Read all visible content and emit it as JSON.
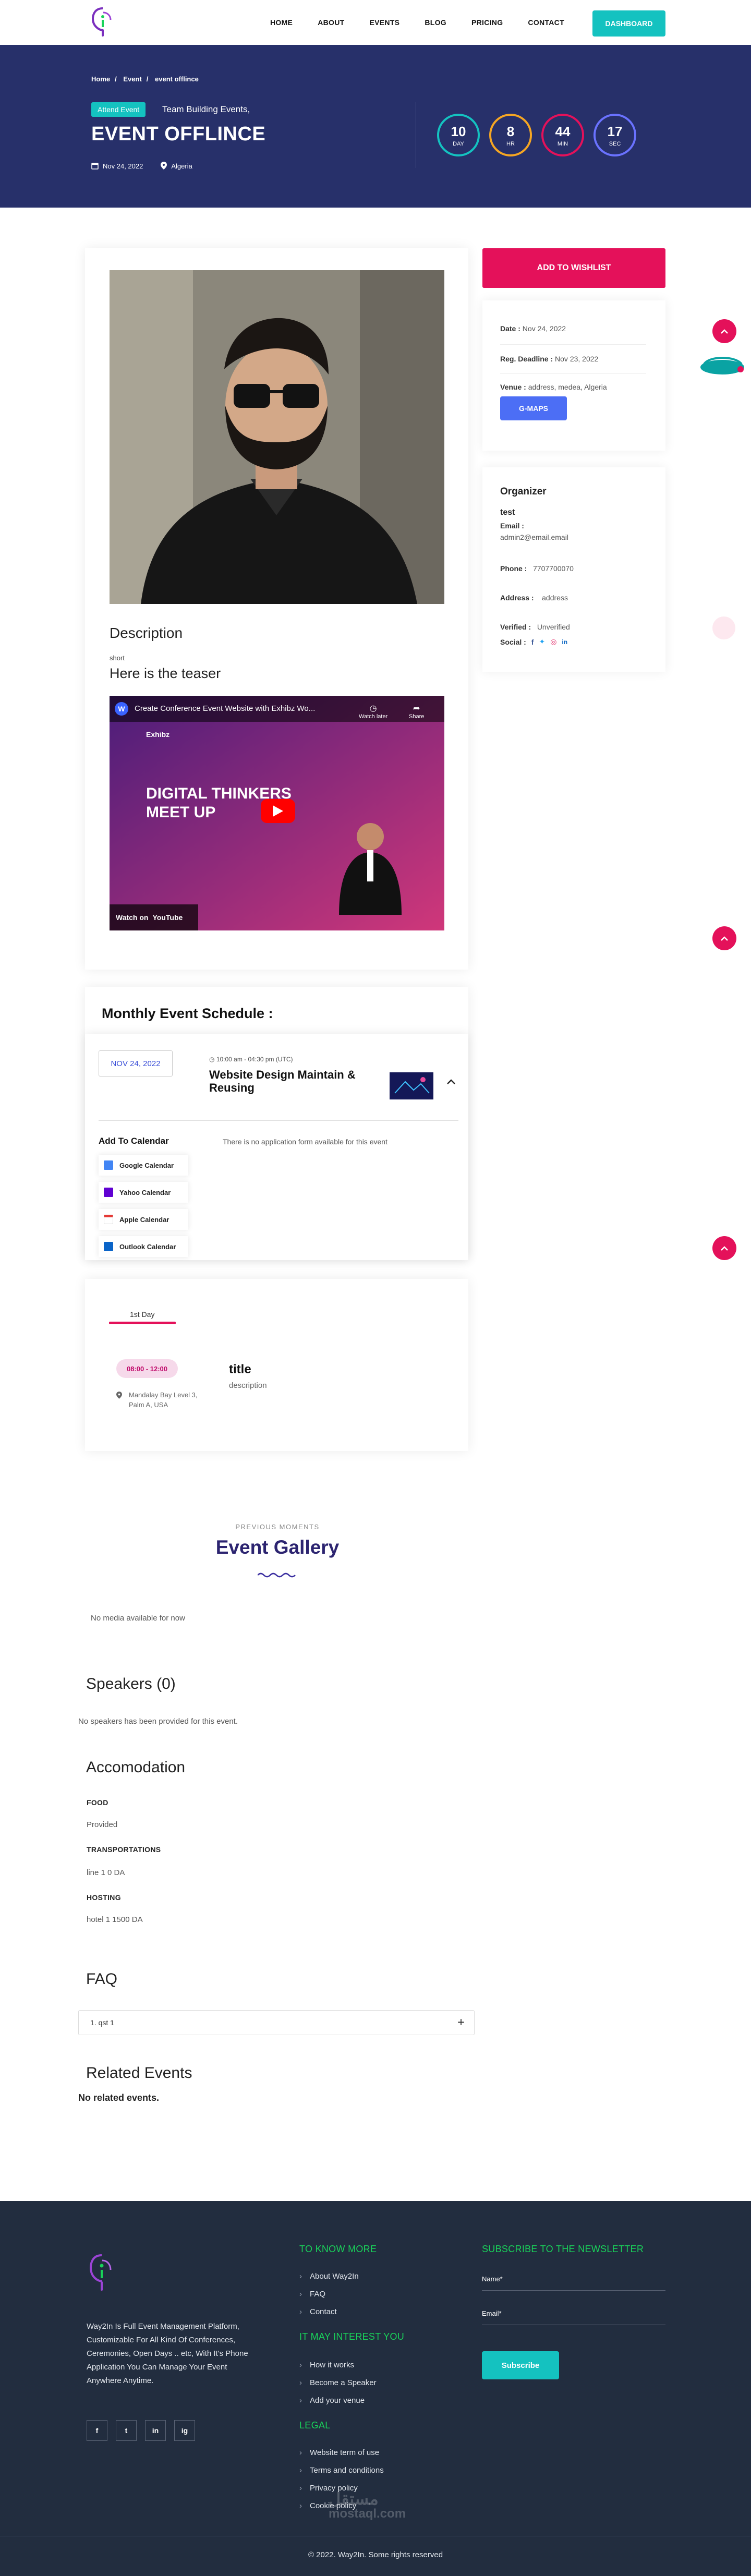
{
  "nav": {
    "items": [
      "HOME",
      "ABOUT",
      "EVENTS",
      "BLOG",
      "PRICING",
      "CONTACT"
    ],
    "dashboard_label": "DASHBOARD"
  },
  "hero": {
    "breadcrumb": [
      "Home",
      "Event",
      "event offlince"
    ],
    "badge": "Attend Event",
    "category": "Team Building Events,",
    "title": "EVENT OFFLINCE",
    "date": "Nov 24, 2022",
    "location": "Algeria",
    "countdown": [
      {
        "value": "10",
        "unit": "DAY",
        "color": "#14c2c0"
      },
      {
        "value": "8",
        "unit": "HR",
        "color": "#f5a623"
      },
      {
        "value": "44",
        "unit": "MIN",
        "color": "#e4115a"
      },
      {
        "value": "17",
        "unit": "SEC",
        "color": "#6a72ff"
      }
    ]
  },
  "main": {
    "description_heading": "Description",
    "short_label": "short",
    "teaser": "Here is the teaser",
    "video": {
      "title": "Create Conference Event Website with Exhibz Wo...",
      "watch_later": "Watch later",
      "share": "Share",
      "brand": "Exhibz",
      "headline_1": "DIGITAL THINKERS",
      "headline_2": "MEET UP",
      "watch_on": "Watch on",
      "youtube": "YouTube"
    }
  },
  "sidebar": {
    "wishlist_label": "ADD TO WISHLIST",
    "date_label": "Date :",
    "date_value": "Nov 24, 2022",
    "deadline_label": "Reg. Deadline :",
    "deadline_value": "Nov 23, 2022",
    "venue_label": "Venue :",
    "venue_value": "address, medea, Algeria",
    "gmaps_label": "G-MAPS",
    "organizer_heading": "Organizer",
    "organizer_name": "test",
    "email_label": "Email :",
    "email_value": "admin2@email.email",
    "phone_label": "Phone :",
    "phone_value": "7707700070",
    "address_label": "Address :",
    "address_value": "address",
    "verified_label": "Verified :",
    "verified_value": "Unverified",
    "social_label": "Social :"
  },
  "schedule": {
    "heading": "Monthly Event Schedule :",
    "date": "NOV 24, 2022",
    "time": "10:00 am - 04:30 pm (UTC)",
    "title": "Website Design Maintain & Reusing",
    "add_to_calendar": "Add To Calendar",
    "no_form": "There is no application form available for this event",
    "calendars": [
      {
        "label": "Google Calendar",
        "color": "#4285f4"
      },
      {
        "label": "Yahoo Calendar",
        "color": "#6001d2"
      },
      {
        "label": "Apple Calendar",
        "color": "#e53935"
      },
      {
        "label": "Outlook Calendar",
        "color": "#0a64c8"
      }
    ]
  },
  "agenda": {
    "day": "1st Day",
    "time": "08:00 - 12:00",
    "location": "Mandalay Bay Level 3, Palm A, USA",
    "title": "title",
    "description": "description"
  },
  "gallery": {
    "pre": "PREVIOUS MOMENTS",
    "heading": "Event Gallery",
    "empty": "No media available for now"
  },
  "speakers": {
    "heading": "Speakers (0)",
    "empty": "No speakers has been provided for this event."
  },
  "accomodation": {
    "heading": "Accomodation",
    "items": [
      {
        "label": "FOOD",
        "value": "Provided"
      },
      {
        "label": "TRANSPORTATIONS",
        "value": "line 1 0 DA"
      },
      {
        "label": "HOSTING",
        "value": "hotel 1 1500 DA"
      }
    ]
  },
  "faq": {
    "heading": "FAQ",
    "items": [
      "1. qst 1"
    ]
  },
  "related": {
    "heading": "Related Events",
    "empty": "No related events."
  },
  "footer": {
    "about": "Way2In Is Full Event Management Platform, Customizable For All Kind Of Conferences, Ceremonies, Open Days .. etc, With It's Phone Application You Can Manage Your Event Anywhere Anytime.",
    "social": [
      "f",
      "t",
      "in",
      "ig"
    ],
    "to_know_heading": "TO KNOW MORE",
    "to_know_links": [
      "About Way2In",
      "FAQ",
      "Contact"
    ],
    "interest_heading": "IT MAY INTEREST YOU",
    "interest_links": [
      "How it works",
      "Become a Speaker",
      "Add your venue"
    ],
    "legal_heading": "LEGAL",
    "legal_links": [
      "Website term of use",
      "Terms and conditions",
      "Privacy policy",
      "Cookie policy"
    ],
    "newsletter_heading": "SUBSCRIBE TO THE NEWSLETTER",
    "name_placeholder": "Name*",
    "email_placeholder": "Email*",
    "subscribe_label": "Subscribe",
    "copyright": "© 2022. Way2In. Some rights reserved",
    "watermark": "مستقل",
    "watermark_sub": "mostaql.com"
  }
}
